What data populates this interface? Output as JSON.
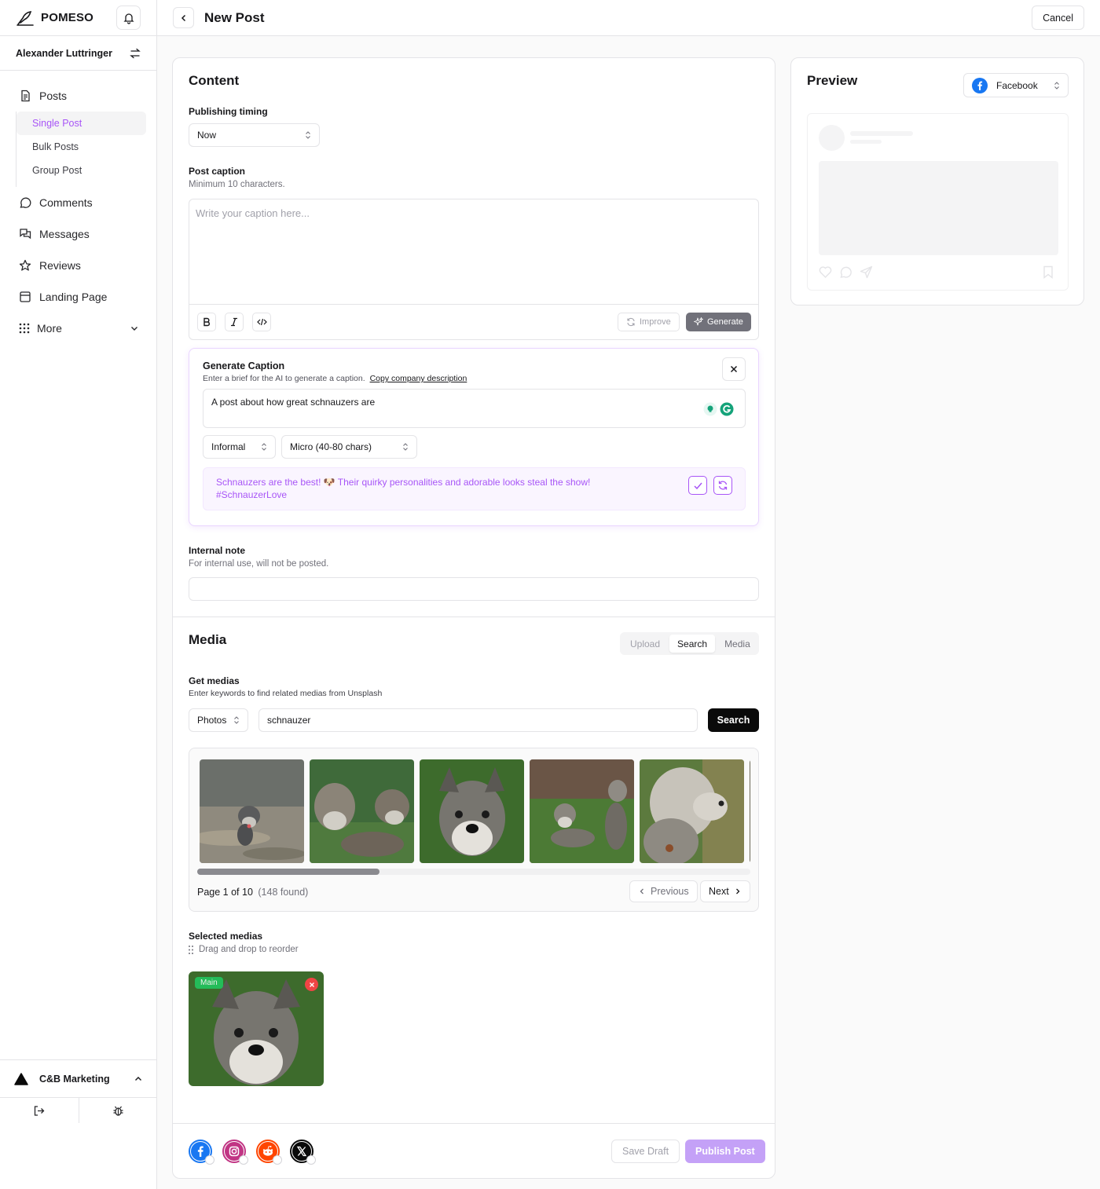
{
  "app": {
    "brand": "POMESO"
  },
  "user": {
    "name": "Alexander Luttringer"
  },
  "nav": {
    "posts": "Posts",
    "sub": [
      "Single Post",
      "Bulk Posts",
      "Group Post"
    ],
    "comments": "Comments",
    "messages": "Messages",
    "reviews": "Reviews",
    "landing": "Landing Page",
    "more": "More"
  },
  "org": {
    "name": "C&B Marketing"
  },
  "header": {
    "title": "New Post",
    "cancel": "Cancel"
  },
  "content": {
    "title": "Content",
    "timing_label": "Publishing timing",
    "timing_value": "Now",
    "caption_label": "Post caption",
    "caption_hint": "Minimum 10 characters.",
    "caption_placeholder": "Write your caption here...",
    "improve": "Improve",
    "generate": "Generate"
  },
  "generator": {
    "title": "Generate Caption",
    "hint": "Enter a brief for the AI to generate a caption.",
    "copy_link": "Copy company description",
    "brief": "A post about how great schnauzers are",
    "tone": "Informal",
    "length": "Micro (40-80 chars)",
    "suggestion_line1": "Schnauzers are the best! 🐶 Their quirky personalities and adorable looks steal the show!",
    "suggestion_line2": "#SchnauzerLove"
  },
  "note": {
    "label": "Internal note",
    "hint": "For internal use, will not be posted."
  },
  "media": {
    "title": "Media",
    "tabs": [
      "Upload",
      "Search",
      "Media"
    ],
    "active_tab": "Search",
    "get_label": "Get medias",
    "get_hint": "Enter keywords to find related medias from Unsplash",
    "type": "Photos",
    "query": "schnauzer",
    "search_btn": "Search",
    "page_text": "Page 1 of 10",
    "found_text": "(148 found)",
    "prev": "Previous",
    "next": "Next",
    "scroll_fraction": 0.33,
    "selected_label": "Selected medias",
    "selected_hint": "Drag and drop to reorder",
    "main_badge": "Main"
  },
  "footer": {
    "networks": [
      "facebook-icon",
      "instagram-icon",
      "reddit-icon",
      "x-icon"
    ],
    "save_draft": "Save Draft",
    "publish": "Publish Post"
  },
  "preview": {
    "title": "Preview",
    "network": "Facebook"
  },
  "colors": {
    "accent": "#a855f7",
    "facebook": "#1877f2",
    "instagram": "#c13584",
    "reddit": "#ff4500",
    "success": "#22c55e",
    "danger": "#ef4444"
  }
}
